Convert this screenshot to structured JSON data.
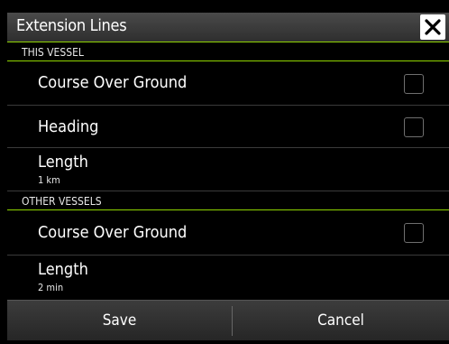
{
  "dialog": {
    "title": "Extension Lines",
    "close_icon": "close-icon"
  },
  "this_vessel": {
    "header": "THIS VESSEL",
    "rows": [
      {
        "label": "Course Over Ground",
        "checked": false
      },
      {
        "label": "Heading",
        "checked": false
      },
      {
        "label": "Length",
        "value": "1 km"
      }
    ]
  },
  "other_vessels": {
    "header": "OTHER VESSELS",
    "rows": [
      {
        "label": "Course Over Ground",
        "checked": false
      },
      {
        "label": "Length",
        "value": "2 min"
      }
    ]
  },
  "footer": {
    "save_label": "Save",
    "cancel_label": "Cancel"
  },
  "colors": {
    "accent": "#8fd400",
    "background": "#000000",
    "titlebar": "#3a3a3a"
  }
}
